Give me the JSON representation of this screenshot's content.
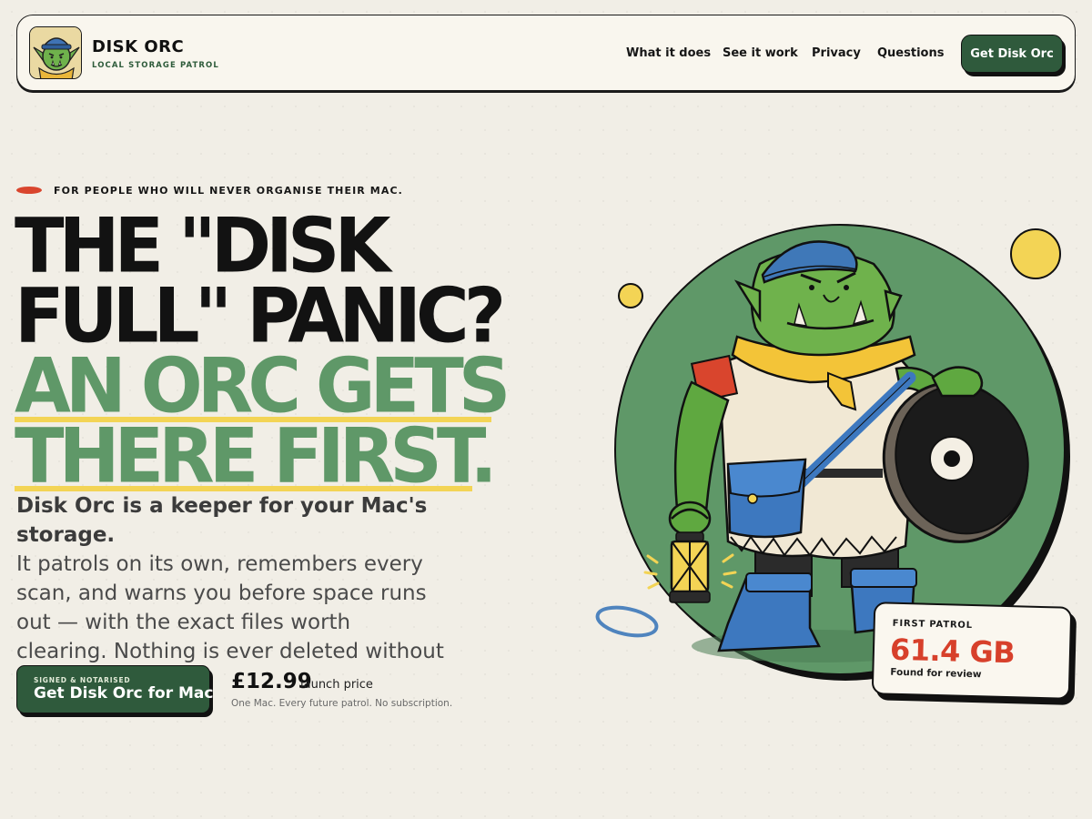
{
  "brand": {
    "name": "DISK ORC",
    "tagline": "LOCAL STORAGE PATROL"
  },
  "nav": {
    "links": [
      {
        "label": "What it does"
      },
      {
        "label": "See it work"
      },
      {
        "label": "Privacy"
      },
      {
        "label": "Questions"
      }
    ],
    "cta_label": "Get Disk Orc"
  },
  "hero": {
    "eyebrow": "FOR PEOPLE WHO WILL NEVER ORGANISE THEIR MAC.",
    "headline_lines": [
      "THE \"DISK",
      "FULL\" PANIC?",
      "AN ORC GETS",
      "THERE FIRST."
    ],
    "lead_bold": "Disk Orc is a keeper for your Mac's storage.",
    "lead_rest": "It patrols on its own, remembers every scan, and warns you before space runs out — with the exact files worth clearing. Nothing is ever deleted without you."
  },
  "cta": {
    "small_label": "SIGNED & NOTARISED",
    "main_label": "Get Disk Orc for Mac",
    "price": "£12.99",
    "price_note": "launch price",
    "price_sub": "One Mac. Every future patrol. No subscription."
  },
  "patrol_card": {
    "label": "FIRST PATROL",
    "value": "61.4 GB",
    "sub": "Found for review"
  },
  "colors": {
    "brand_green": "#2f5a3c",
    "headline_green": "#5f9868",
    "accent_red": "#d7402b",
    "highlight_yellow": "#f3d455",
    "background": "#f1eee6"
  },
  "icons": {
    "logo": "orc-face-icon",
    "mascot": "orc-mascot-illustration"
  }
}
